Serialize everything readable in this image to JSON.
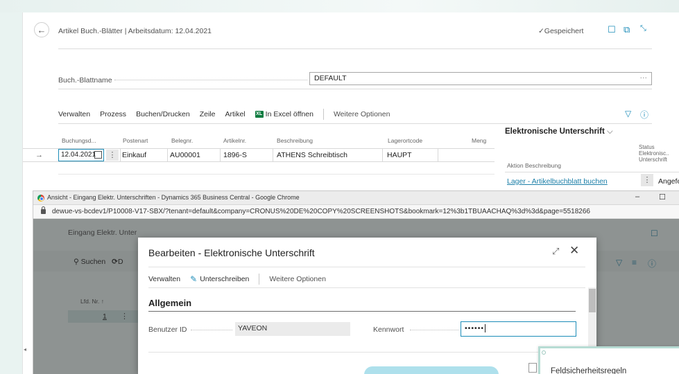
{
  "page": {
    "title": "Artikel Buch.-Blätter | Arbeitsdatum: 12.04.2021",
    "saved": "✓Gespeichert",
    "journal_label": "Buch.-Blattname",
    "journal_value": "DEFAULT",
    "journal_more": "···",
    "actions": [
      "Verwalten",
      "Prozess",
      "Buchen/Drucken",
      "Zeile",
      "Artikel"
    ],
    "excel_label": "In Excel öffnen",
    "excel_badge": "XL",
    "more_options": "Weitere Optionen",
    "columns": [
      "Buchungsd...",
      "Postenart",
      "Belegnr.",
      "Artikelnr.",
      "Beschreibung",
      "Lagerortcode",
      "Meng"
    ],
    "row": {
      "date": "12.04.2021",
      "entry_type": "Einkauf",
      "doc_no": "AU00001",
      "item_no": "1896-S",
      "description": "ATHENS Schreibtisch",
      "location": "HAUPT"
    }
  },
  "factbox": {
    "title": "Elektronische Unterschrift",
    "col_action": "Aktion Beschreibung",
    "col_status": [
      "Status",
      "Elektronisc..",
      "Unterschrift"
    ],
    "link": "Lager - Artikelbuchblatt buchen",
    "status": "Angeforde"
  },
  "chrome": {
    "title": "Ansicht - Eingang Elektr. Unterschriften - Dynamics 365 Business Central - Google Chrome",
    "url": "dewue-vs-bcdev1/P10008-V17-SBX/?tenant=default&company=CRONUS%20DE%20COPY%20SCREENSHOTS&bookmark=12%3b1TBUAACHAQ%3d%3d&page=5518266",
    "minimize": "–",
    "maximize": "☐"
  },
  "inner": {
    "title": "Eingang Elektr. Unter",
    "search": "Suchen",
    "search_trail": "D",
    "col": "Lfd. Nr. ↑",
    "row_num": "1"
  },
  "modal": {
    "title": "Bearbeiten - Elektronische Unterschrift",
    "actions": [
      "Verwalten",
      "Unterschreiben",
      "Weitere Optionen"
    ],
    "group": "Allgemein",
    "user_label": "Benutzer ID",
    "user_value": "YAVEON",
    "pass_label": "Kennwort",
    "pass_value": "••••••"
  },
  "side_panel": {
    "text": "Feldsicherheitsregeln"
  }
}
